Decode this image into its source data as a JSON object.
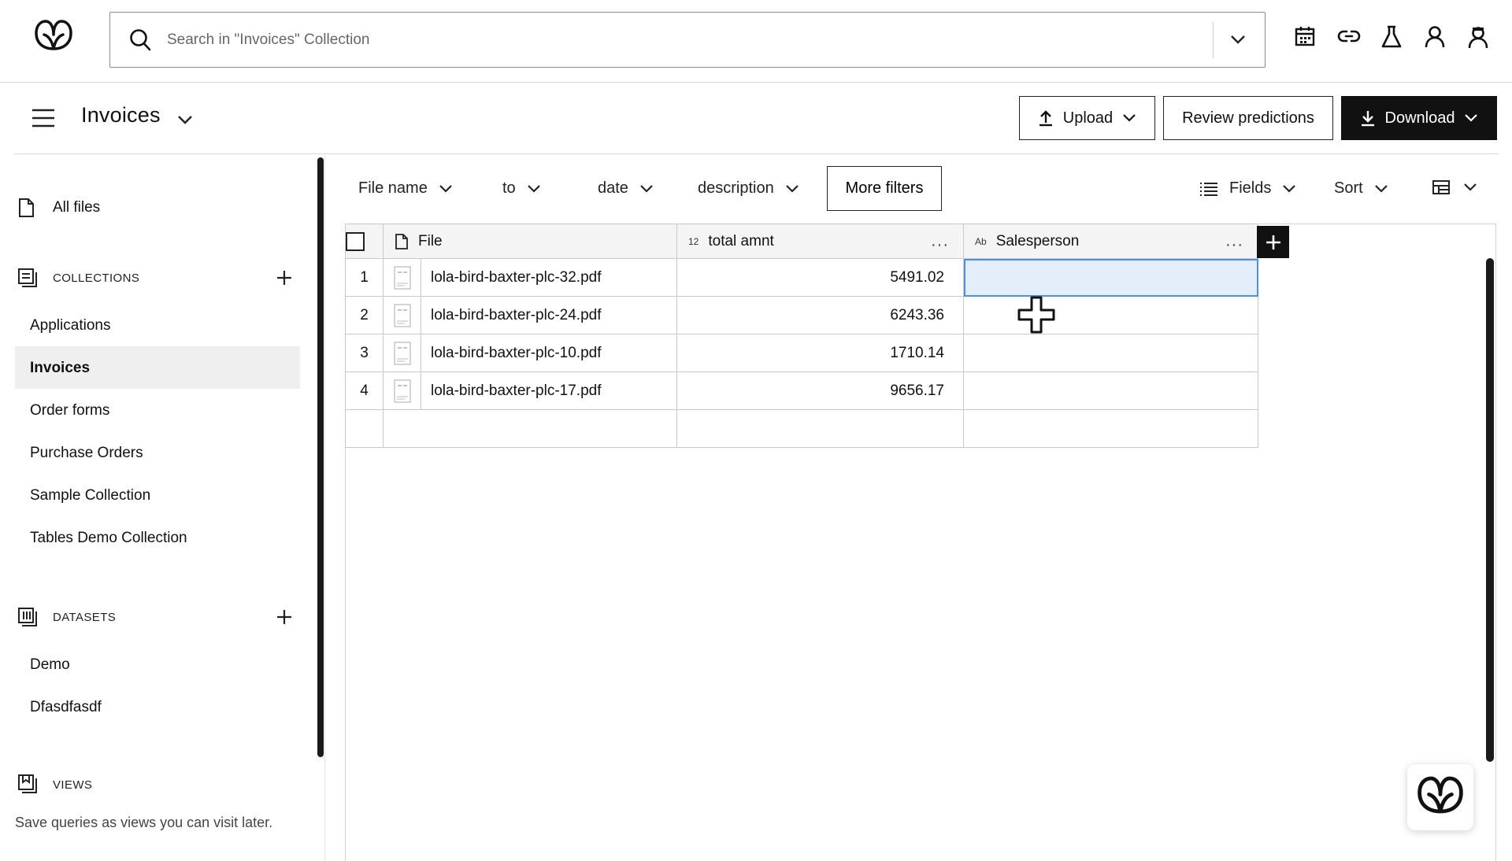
{
  "search": {
    "placeholder": "Search in \"Invoices\" Collection"
  },
  "header": {
    "title": "Invoices",
    "upload_label": "Upload",
    "review_label": "Review predictions",
    "download_label": "Download"
  },
  "sidebar": {
    "all_files": "All files",
    "collections_heading": "COLLECTIONS",
    "collections": [
      {
        "label": "Applications"
      },
      {
        "label": "Invoices",
        "selected": true
      },
      {
        "label": "Order forms"
      },
      {
        "label": "Purchase Orders"
      },
      {
        "label": "Sample Collection"
      },
      {
        "label": "Tables Demo Collection"
      }
    ],
    "datasets_heading": "DATASETS",
    "datasets": [
      {
        "label": "Demo"
      },
      {
        "label": "Dfasdfasdf"
      }
    ],
    "views_heading": "VIEWS",
    "views_description": "Save queries as views you can visit later."
  },
  "filters": {
    "file_name": "File name",
    "to": "to",
    "date": "date",
    "description": "description",
    "more_filters": "More filters",
    "fields": "Fields",
    "sort": "Sort"
  },
  "table": {
    "columns": {
      "file": "File",
      "total_type": "12",
      "total": "total amnt",
      "sales_type": "Ab",
      "sales": "Salesperson",
      "more": "···"
    },
    "rows": [
      {
        "index": "1",
        "file": "lola-bird-baxter-plc-32.pdf",
        "total": "5491.02",
        "salesperson": ""
      },
      {
        "index": "2",
        "file": "lola-bird-baxter-plc-24.pdf",
        "total": "6243.36",
        "salesperson": ""
      },
      {
        "index": "3",
        "file": "lola-bird-baxter-plc-10.pdf",
        "total": "1710.14",
        "salesperson": ""
      },
      {
        "index": "4",
        "file": "lola-bird-baxter-plc-17.pdf",
        "total": "9656.17",
        "salesperson": ""
      }
    ]
  },
  "colors": {
    "accent": "#111111",
    "selection": "#e4eefa",
    "selection_border": "#4d8fe0"
  }
}
